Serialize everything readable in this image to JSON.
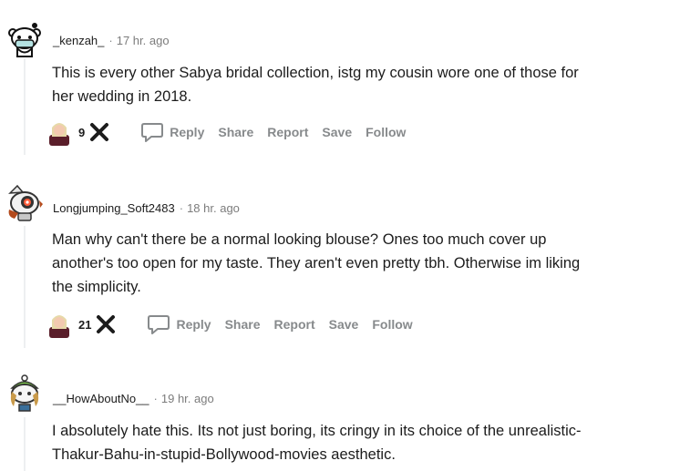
{
  "comments": [
    {
      "username": "_kenzah_",
      "separator": "·",
      "time": "17 hr. ago",
      "lines": [
        "This is every other Sabya bridal collection, istg my cousin wore one of those for",
        "her wedding in 2018."
      ],
      "score": "9"
    },
    {
      "username": "Longjumping_Soft2483",
      "separator": "·",
      "time": "18 hr. ago",
      "lines": [
        "Man why can't there be a normal looking blouse? Ones too much cover up",
        "another's too open for my taste. They aren't even pretty tbh. Otherwise im liking",
        "the simplicity."
      ],
      "score": "21"
    },
    {
      "username": "__HowAboutNo__",
      "separator": "·",
      "time": "19 hr. ago",
      "lines": [
        "I absolutely hate this. Its not just boring, its cringy in its choice of the unrealistic-",
        "Thakur-Bahu-in-stupid-Bollywood-movies aesthetic."
      ]
    }
  ],
  "actions": {
    "reply": "Reply",
    "share": "Share",
    "report": "Report",
    "save": "Save",
    "follow": "Follow"
  },
  "icons": {
    "award": "award-icon",
    "downvote": "downvote-x-icon",
    "reply": "speech-bubble-icon"
  },
  "colors": {
    "text": "#1c1c1c",
    "meta": "#7c7c7c",
    "action": "#878a8c",
    "thread_line": "#edeff1"
  }
}
